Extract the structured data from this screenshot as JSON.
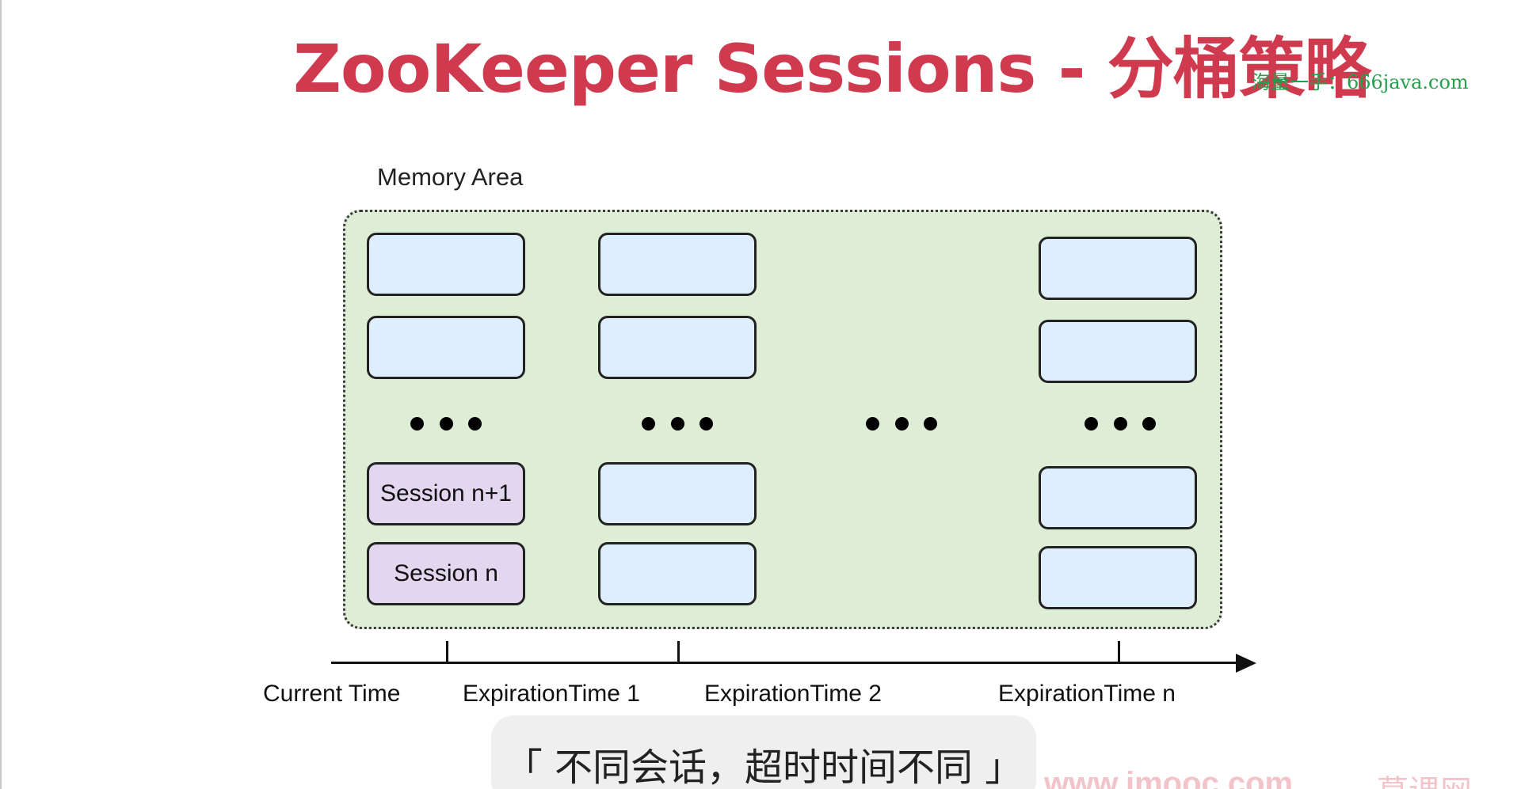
{
  "title": "ZooKeeper Sessions - 分桶策略",
  "watermark": "海量一手：666java.com",
  "diagram": {
    "memory_label": "Memory Area",
    "session_labels": {
      "session_n_plus_1": "Session n+1",
      "session_n": "Session n"
    },
    "timeline": {
      "current": "Current Time",
      "exp1": "ExpirationTime 1",
      "exp2": "ExpirationTime 2",
      "expn": "ExpirationTime n"
    }
  },
  "subtitle": "「 不同会话，超时时间不同 」",
  "corner_watermark": {
    "site": "www.imooc.com",
    "brand": "慕课网"
  },
  "colors": {
    "title": "#cf3a4f",
    "watermark": "#23a04a",
    "memory_area": "#deeed6",
    "session_box": "#dfeefd",
    "session_box_highlight": "#e3d6ef"
  }
}
